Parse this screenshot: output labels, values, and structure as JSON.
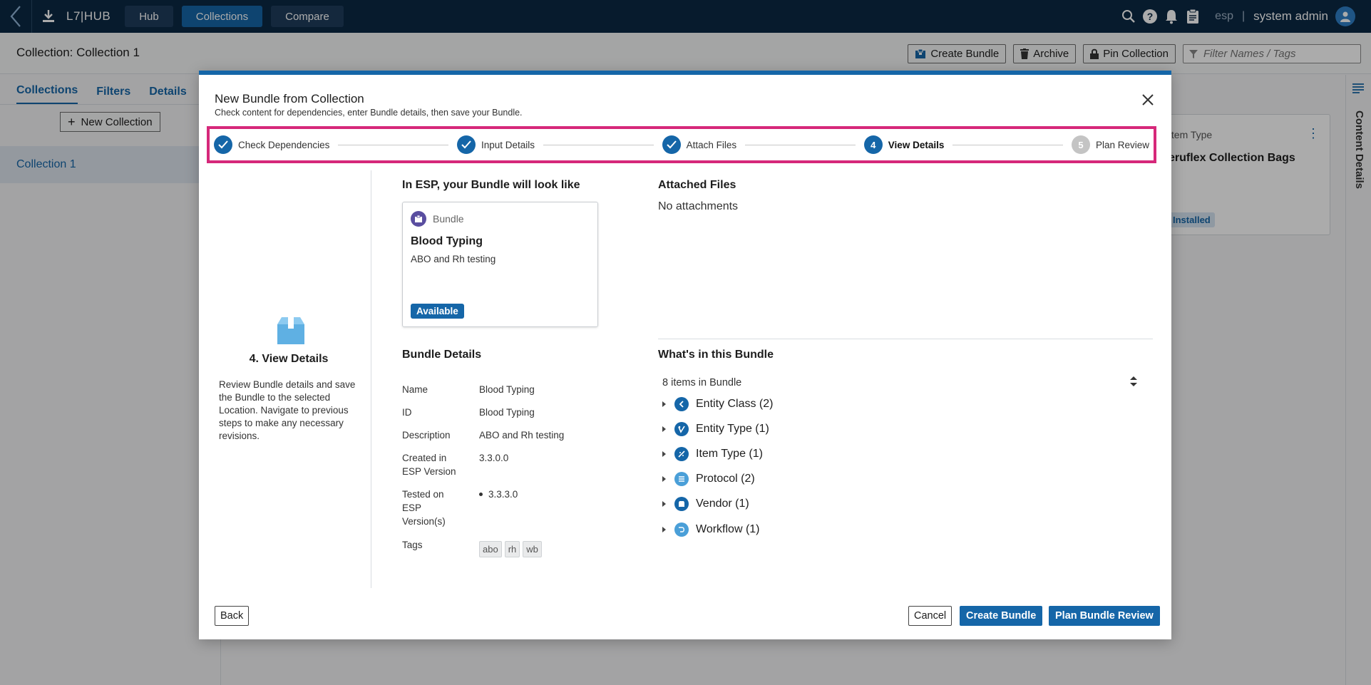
{
  "topbar": {
    "logo": "L7|HUB",
    "nav": [
      "Hub",
      "Collections",
      "Compare"
    ],
    "active_nav": "Collections",
    "tenant": "esp",
    "separator": "|",
    "user": "system admin"
  },
  "page": {
    "title": "Collection: Collection 1",
    "actions": {
      "create_bundle": "Create Bundle",
      "archive": "Archive",
      "pin_collection": "Pin Collection"
    },
    "filter_placeholder": "Filter Names / Tags"
  },
  "sidebar": {
    "tabs": [
      "Collections",
      "Filters",
      "Details"
    ],
    "new_collection": "New Collection",
    "items": [
      "Collection 1"
    ]
  },
  "background_card": {
    "type": "Item Type",
    "name": "eruflex Collection Bags",
    "badge": "Installed"
  },
  "right_rail": {
    "label": "Content Details"
  },
  "modal": {
    "title": "New Bundle from Collection",
    "subtitle": "Check content for dependencies, enter Bundle details, then save your Bundle.",
    "steps": [
      {
        "label": "Check Dependencies",
        "state": "done"
      },
      {
        "label": "Input Details",
        "state": "done"
      },
      {
        "label": "Attach Files",
        "state": "done"
      },
      {
        "label": "View Details",
        "state": "current",
        "number": "4"
      },
      {
        "label": "Plan Review",
        "state": "pending",
        "number": "5"
      }
    ],
    "left": {
      "step_title": "4. View Details",
      "step_desc": "Review Bundle details and save the Bundle to the selected Location. Navigate to previous steps to make any necessary revisions."
    },
    "preview": {
      "heading": "In ESP, your Bundle will look like",
      "type": "Bundle",
      "name": "Blood Typing",
      "desc": "ABO and Rh testing",
      "status": "Available"
    },
    "details": {
      "heading": "Bundle Details",
      "name_label": "Name",
      "name_value": "Blood Typing",
      "id_label": "ID",
      "id_value": "Blood Typing",
      "desc_label": "Description",
      "desc_value": "ABO and Rh testing",
      "created_label": "Created in ESP Version",
      "created_value": "3.3.0.0",
      "tested_label": "Tested on ESP Version(s)",
      "tested_values": [
        "3.3.3.0"
      ],
      "tags_label": "Tags",
      "tags": [
        "abo",
        "rh",
        "wb"
      ]
    },
    "attachments": {
      "heading": "Attached Files",
      "empty": "No attachments"
    },
    "contents": {
      "heading": "What's in this Bundle",
      "count": "8 items in Bundle",
      "items": [
        {
          "label": "Entity Class (2)",
          "icon": "entity-class-icon",
          "color": "#1566a8"
        },
        {
          "label": "Entity Type (1)",
          "icon": "entity-type-icon",
          "color": "#1566a8"
        },
        {
          "label": "Item Type (1)",
          "icon": "item-type-icon",
          "color": "#1566a8"
        },
        {
          "label": "Protocol (2)",
          "icon": "protocol-icon",
          "color": "#4a9fd8"
        },
        {
          "label": "Vendor (1)",
          "icon": "vendor-icon",
          "color": "#1566a8"
        },
        {
          "label": "Workflow (1)",
          "icon": "workflow-icon",
          "color": "#4a9fd8"
        }
      ]
    },
    "footer": {
      "back": "Back",
      "cancel": "Cancel",
      "create": "Create Bundle",
      "plan": "Plan Bundle Review"
    }
  },
  "colors": {
    "topbar": "#0b2944",
    "primary": "#1566a8",
    "stepper_highlight": "#d6287a"
  }
}
